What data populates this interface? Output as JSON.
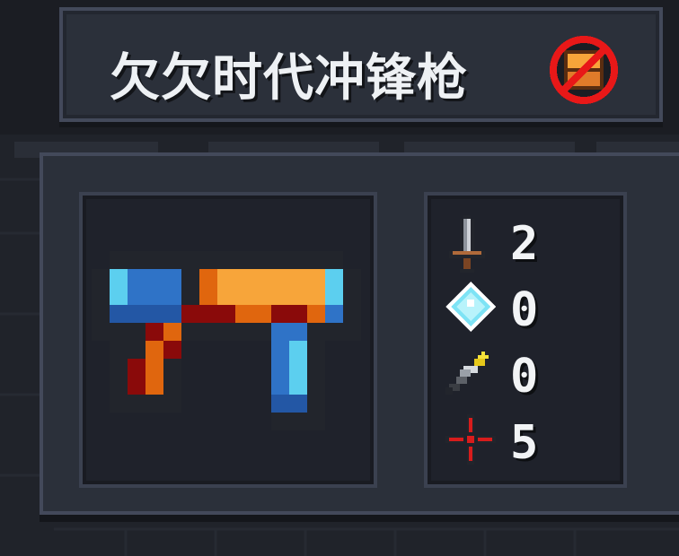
{
  "weapon": {
    "name": "欠欠时代冲锋枪",
    "no_chest_icon": "no-chest-icon",
    "sprite_icon": "smg-pixel-weapon"
  },
  "stats": [
    {
      "id": "damage",
      "icon": "sword-icon",
      "value": "2"
    },
    {
      "id": "energy_cost",
      "icon": "crystal-icon",
      "value": "0"
    },
    {
      "id": "crit",
      "icon": "crit-knife-icon",
      "value": "0"
    },
    {
      "id": "inaccuracy",
      "icon": "crosshair-icon",
      "value": "5"
    }
  ],
  "colors": {
    "panel": "#2b303a",
    "border": "#43495a",
    "inner": "#1f222b",
    "text": "#f2f4f6",
    "weapon_blue": "#2f73c7",
    "weapon_orange": "#f7a53a",
    "weapon_red": "#8a0a0a"
  }
}
